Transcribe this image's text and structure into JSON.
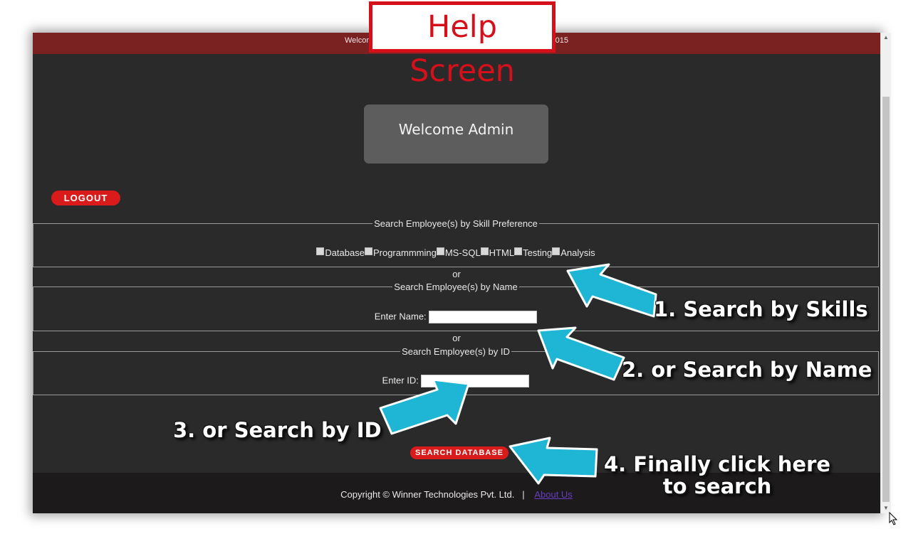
{
  "topbar": {
    "text_left": "Welcom",
    "text_right": "015"
  },
  "welcome": {
    "text": "Welcome Admin"
  },
  "buttons": {
    "logout": "LOGOUT",
    "search": "SEARCH DATABASE"
  },
  "skills_section": {
    "legend": "Search Employee(s) by Skill Preference",
    "options": [
      "Database",
      "Programmming",
      "MS-SQL",
      "HTML",
      "Testing",
      "Analysis"
    ]
  },
  "or_label": "or",
  "name_section": {
    "legend": "Search Employee(s) by Name",
    "label": "Enter Name:",
    "value": ""
  },
  "id_section": {
    "legend": "Search Employee(s) by ID",
    "label": "Enter ID:",
    "value": ""
  },
  "footer": {
    "copyright": "Copyright © Winner Technologies Pvt. Ltd.",
    "separator": "|",
    "about_link": "About Us"
  },
  "help_title": "Help Screen",
  "annotations": {
    "step1": "1. Search by Skills",
    "step2": "2. or Search by Name",
    "step3": "3. or Search by ID",
    "step4_line1": "4. Finally click here",
    "step4_line2": "to search"
  },
  "colors": {
    "background": "#2b2a2b",
    "topbar": "#7a2121",
    "accent_red": "#d91b1b",
    "arrow_cyan": "#1fb6d6",
    "help_border": "#d6101a"
  },
  "icons": {
    "checkbox": "checkbox-icon",
    "arrow": "arrow-icon",
    "cursor": "mouse-cursor-icon"
  }
}
